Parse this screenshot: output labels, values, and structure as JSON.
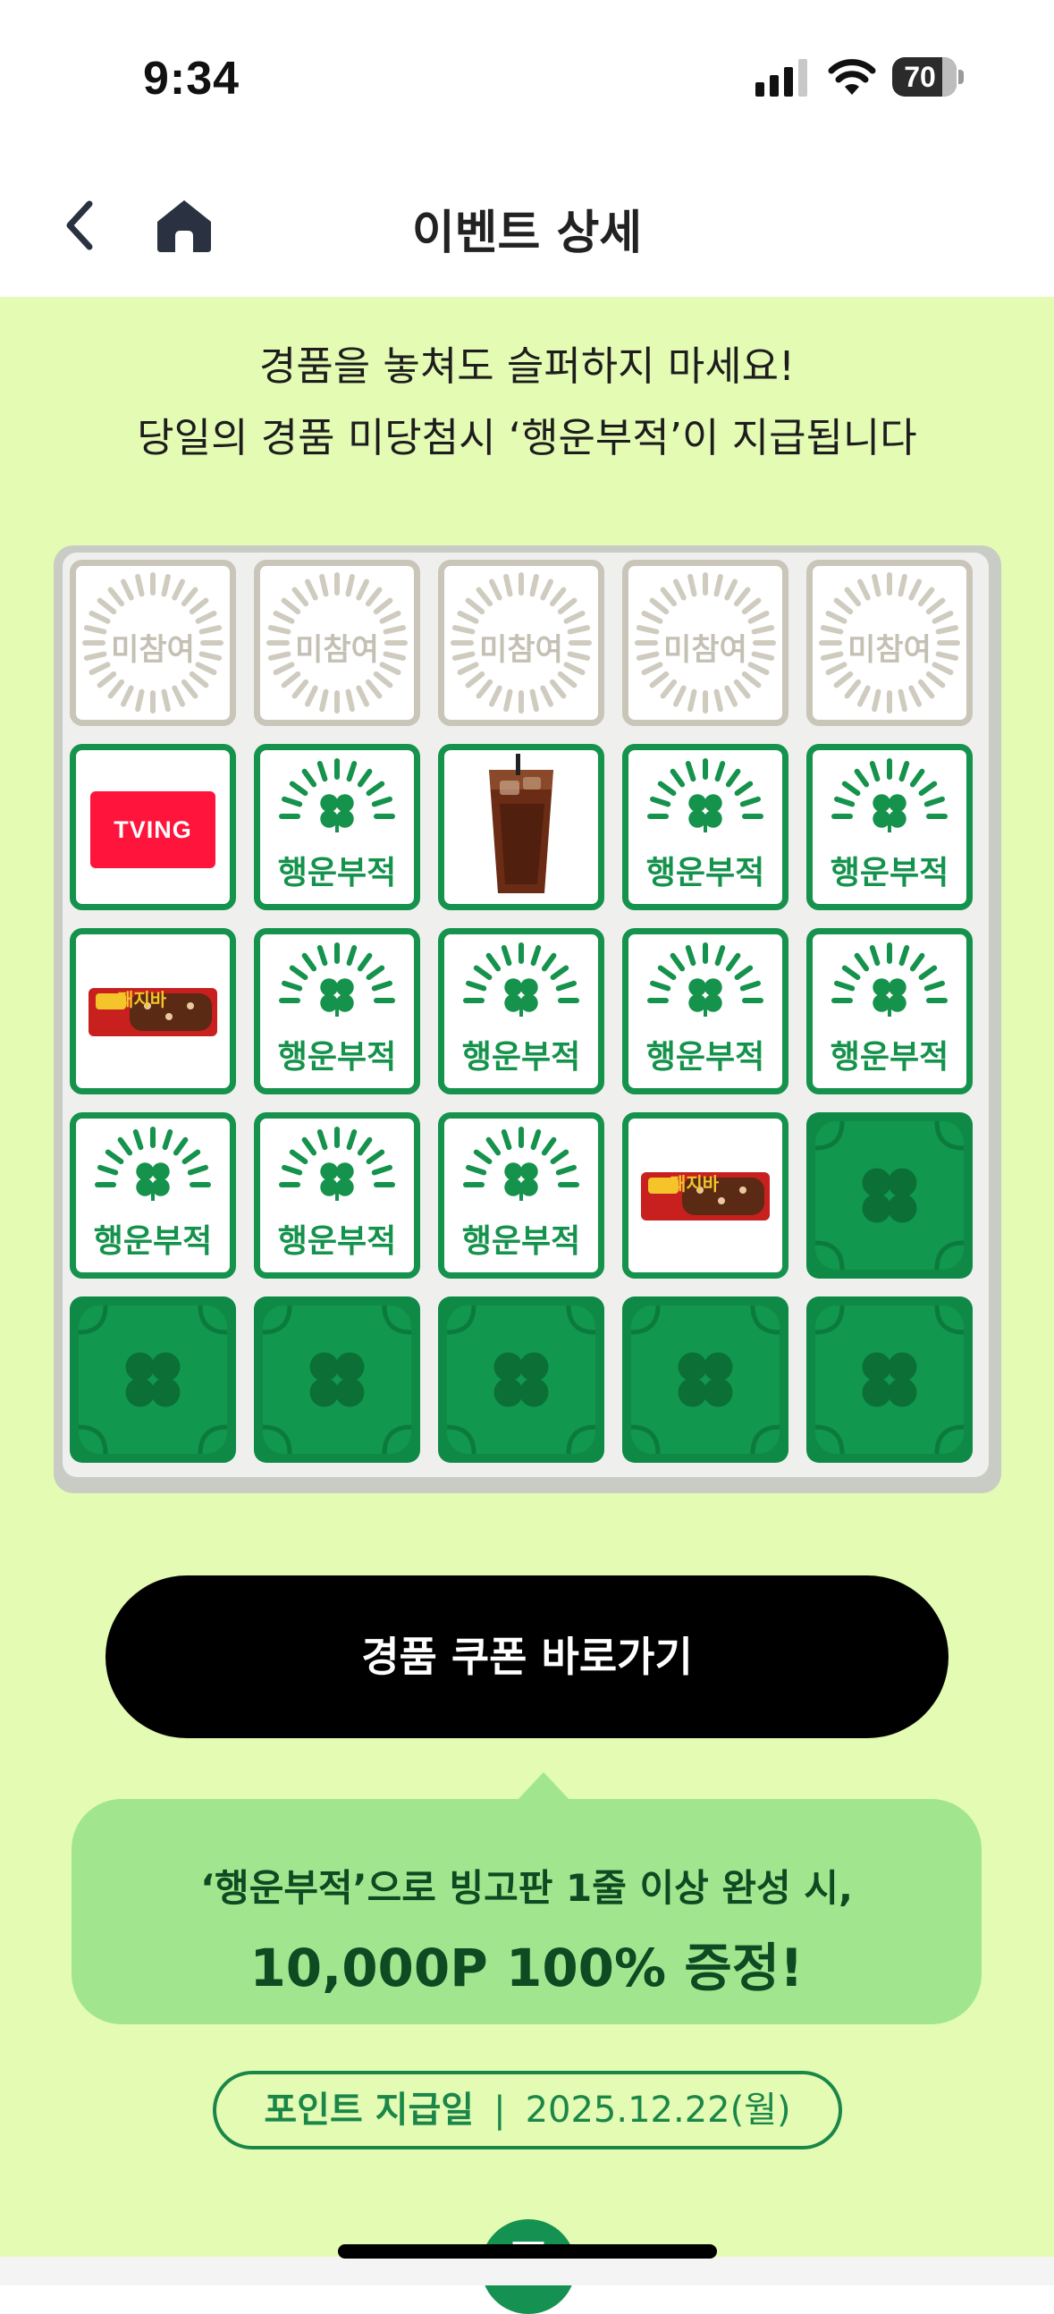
{
  "status": {
    "time": "9:34",
    "battery": "70"
  },
  "nav": {
    "title": "이벤트 상세",
    "back_icon": "chevron-left-icon",
    "home_icon": "home-icon"
  },
  "headline": {
    "line1": "경품을 놓쳐도 슬퍼하지 마세요!",
    "line2": "당일의 경품 미당첨시 ‘행운부적’이 지급됩니다"
  },
  "bingo": {
    "cells": [
      {
        "type": "miss",
        "label": "미참여"
      },
      {
        "type": "miss",
        "label": "미참여"
      },
      {
        "type": "miss",
        "label": "미참여"
      },
      {
        "type": "miss",
        "label": "미참여"
      },
      {
        "type": "miss",
        "label": "미참여"
      },
      {
        "type": "tving",
        "label": "TVING"
      },
      {
        "type": "luck",
        "label": "행운부적"
      },
      {
        "type": "coffee",
        "label": ""
      },
      {
        "type": "luck",
        "label": "행운부적"
      },
      {
        "type": "luck",
        "label": "행운부적"
      },
      {
        "type": "snack",
        "label": "돼지바"
      },
      {
        "type": "luck",
        "label": "행운부적"
      },
      {
        "type": "luck",
        "label": "행운부적"
      },
      {
        "type": "luck",
        "label": "행운부적"
      },
      {
        "type": "luck",
        "label": "행운부적"
      },
      {
        "type": "luck",
        "label": "행운부적"
      },
      {
        "type": "luck",
        "label": "행운부적"
      },
      {
        "type": "luck",
        "label": "행운부적"
      },
      {
        "type": "snack",
        "label": "돼지바"
      },
      {
        "type": "closed",
        "label": ""
      },
      {
        "type": "closed",
        "label": ""
      },
      {
        "type": "closed",
        "label": ""
      },
      {
        "type": "closed",
        "label": ""
      },
      {
        "type": "closed",
        "label": ""
      },
      {
        "type": "closed",
        "label": ""
      }
    ]
  },
  "cta": {
    "label": "경품 쿠폰 바로가기"
  },
  "tooltip": {
    "line1": "‘행운부적’으로 빙고판 1줄 이상 완성 시,",
    "line2": "10,000P 100% 증정!"
  },
  "payday": {
    "label": "포인트 지급일",
    "separator": "|",
    "date": "2025.12.22(월)"
  },
  "fab": {
    "label": "T"
  },
  "colors": {
    "background": "#e4fbb4",
    "brand_green": "#15924c",
    "tooltip": "#a1e68f"
  }
}
